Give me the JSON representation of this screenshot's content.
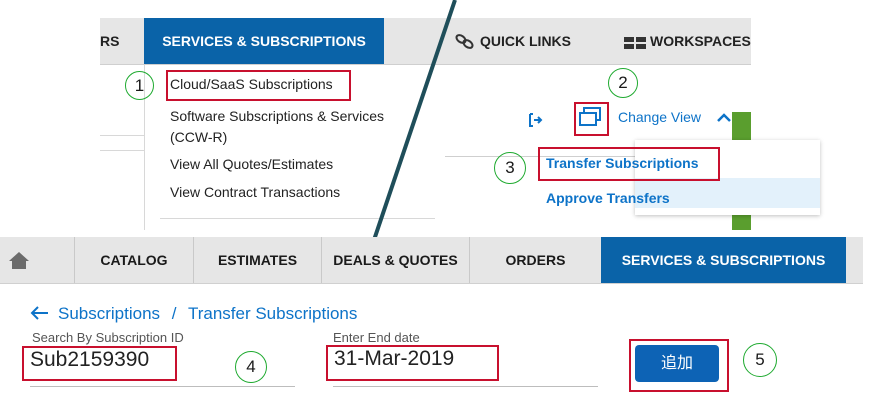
{
  "top": {
    "nav": {
      "partial_left": "RS",
      "active": "SERVICES & SUBSCRIPTIONS",
      "quick_links": "QUICK LINKS",
      "workspaces": "WORKSPACES"
    },
    "dropdown": {
      "items": [
        "Cloud/SaaS Subscriptions",
        "Software Subscriptions & Services",
        "(CCW-R)",
        "View All Quotes/Estimates",
        "View Contract Transactions"
      ]
    },
    "change_view": "Change View",
    "menu": {
      "transfer": "Transfer Subscriptions",
      "approve": "Approve Transfers"
    },
    "steps": [
      "1",
      "2",
      "3"
    ]
  },
  "bottom": {
    "nav": {
      "items": [
        "CATALOG",
        "ESTIMATES",
        "DEALS & QUOTES",
        "ORDERS",
        "SERVICES & SUBSCRIPTIONS"
      ]
    },
    "breadcrumb": {
      "root": "Subscriptions",
      "sep": "/",
      "current": "Transfer Subscriptions"
    },
    "search_label": "Search By Subscription ID",
    "search_value": "Sub2159390",
    "date_label": "Enter End date",
    "date_value": "31-Mar-2019",
    "add_button": "追加",
    "steps": [
      "4",
      "5"
    ]
  },
  "colors": {
    "nav_active": "#0a63a8",
    "link": "#0d73c8",
    "highlight": "#c8102e",
    "step_circle": "#1faa30"
  }
}
